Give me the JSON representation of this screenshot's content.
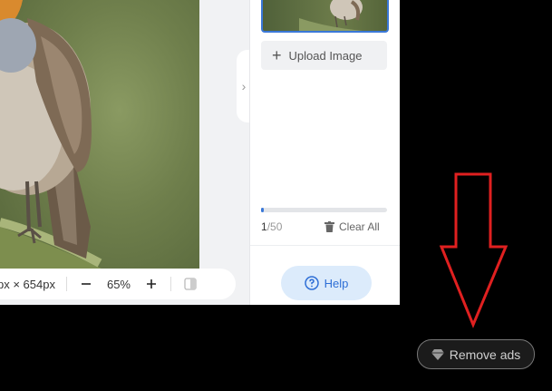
{
  "toolbar": {
    "dimensions": "px × 654px",
    "zoom": "65%",
    "zoom_out_icon": "minus-icon",
    "zoom_in_icon": "plus-icon",
    "compare_icon": "compare-icon"
  },
  "sidebar": {
    "upload_label": "Upload Image",
    "progress_fraction": 0.02,
    "counter_current": "1",
    "counter_total": "/50",
    "clear_label": "Clear All",
    "help_label": "Help"
  },
  "ads": {
    "remove_label": "Remove ads",
    "icon": "diamond-icon"
  },
  "colors": {
    "accent": "#3a78d8",
    "help_bg": "#dcebfb",
    "annotation": "#e02020"
  }
}
